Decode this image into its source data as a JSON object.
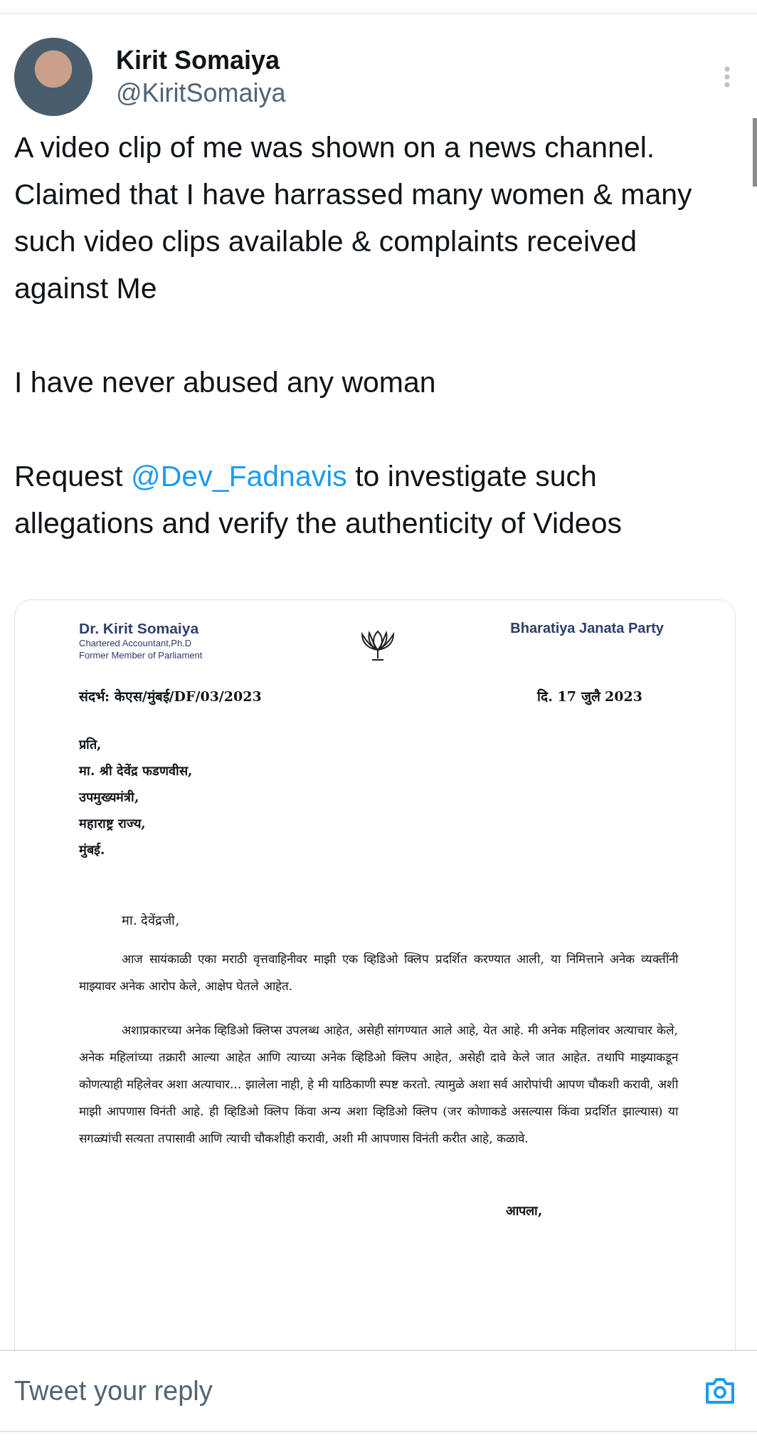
{
  "author": {
    "name": "Kirit Somaiya",
    "handle": "@KiritSomaiya"
  },
  "tweet": [
    {
      "parts": [
        {
          "kind": "text",
          "text": "A video clip of me was shown on a news channel. Claimed that I have harrassed many women & many such video clips available & complaints received against Me"
        }
      ]
    },
    {
      "parts": [
        {
          "kind": "text",
          "text": "I have never abused any woman"
        }
      ]
    },
    {
      "parts": [
        {
          "kind": "text",
          "text": "Request "
        },
        {
          "kind": "mention",
          "text": "@Dev_Fadnavis"
        },
        {
          "kind": "text",
          "text": " to investigate such allegations and verify the authenticity of Videos"
        }
      ]
    }
  ],
  "letter": {
    "sender_name": "Dr. Kirit Somaiya",
    "sender_lines": [
      "Chartered Accountant,Ph.D",
      "Former Member of Parliament"
    ],
    "party": "Bharatiya Janata Party",
    "reference": "संदर्भ: केएस/मुंबई/DF/03/2023",
    "date": "दि.  17 जुलै 2023",
    "address": [
      "प्रति,",
      "मा. श्री देवेंद्र फडणवीस,",
      "उपमुख्यमंत्री,",
      "महाराष्ट्र राज्य,",
      "मुंबई."
    ],
    "salutation": "मा. देवेंद्रजी,",
    "paragraphs": [
      "आज सायंकाळी एका मराठी वृत्तवाहिनीवर माझी एक व्हिडिओ क्लिप प्रदर्शित करण्यात आली, या निमित्ताने अनेक व्यक्तींनी माझ्यावर अनेक आरोप केले, आक्षेप घेतले आहेत.",
      "अशाप्रकारच्या अनेक व्हिडिओ क्लिप्स उपलब्ध आहेत, असेही सांगण्यात आले आहे, येत आहे. मी अनेक महिलांवर अत्याचार केले, अनेक महिलांच्या तक्रारी आल्या आहेत आणि त्याच्या अनेक व्हिडिओ क्लिप आहेत, असेही दावे केले जात आहेत. तथापि माझ्याकडून कोणत्याही महिलेवर अशा अत्याचार... झालेला नाही, हे मी याठिकाणी स्पष्ट करतो. त्यामुळे अशा सर्व आरोपांची आपण चौकशी करावी, अशी माझी आपणास विनंती आहे. ही व्हिडिओ क्लिप किंवा अन्य अशा व्हिडिओ क्लिप (जर कोणाकडे असल्यास किंवा प्रदर्शित झाल्यास) या सगळ्यांची सत्यता तपासावी आणि त्याची चौकशीही करावी, अशी मी आपणास विनंती करीत आहे, कळावे."
    ],
    "closing": "आपला,"
  },
  "reply": {
    "placeholder": "Tweet your reply"
  }
}
